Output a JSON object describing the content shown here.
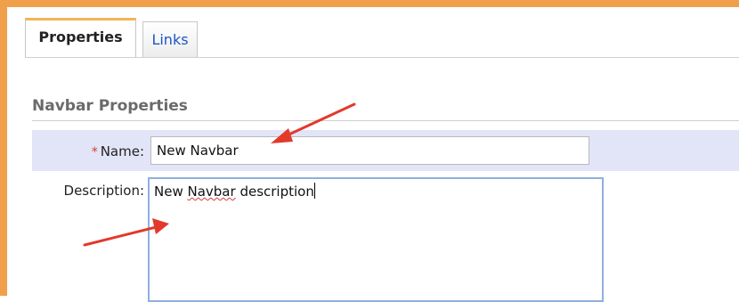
{
  "tabs": [
    {
      "label": "Properties",
      "active": true
    },
    {
      "label": "Links",
      "active": false
    }
  ],
  "section": {
    "title": "Navbar Properties"
  },
  "form": {
    "name": {
      "required_mark": "*",
      "label": "Name:",
      "value": "New Navbar"
    },
    "description": {
      "label": "Description:",
      "value_word_1": "New",
      "value_misspelled": "Navbar",
      "value_rest": "description"
    }
  },
  "colors": {
    "frame": "#f0a04b",
    "annotation_arrow": "#e2392a",
    "name_row_bg": "#e2e4f7",
    "link_tab": "#1b55c7"
  }
}
